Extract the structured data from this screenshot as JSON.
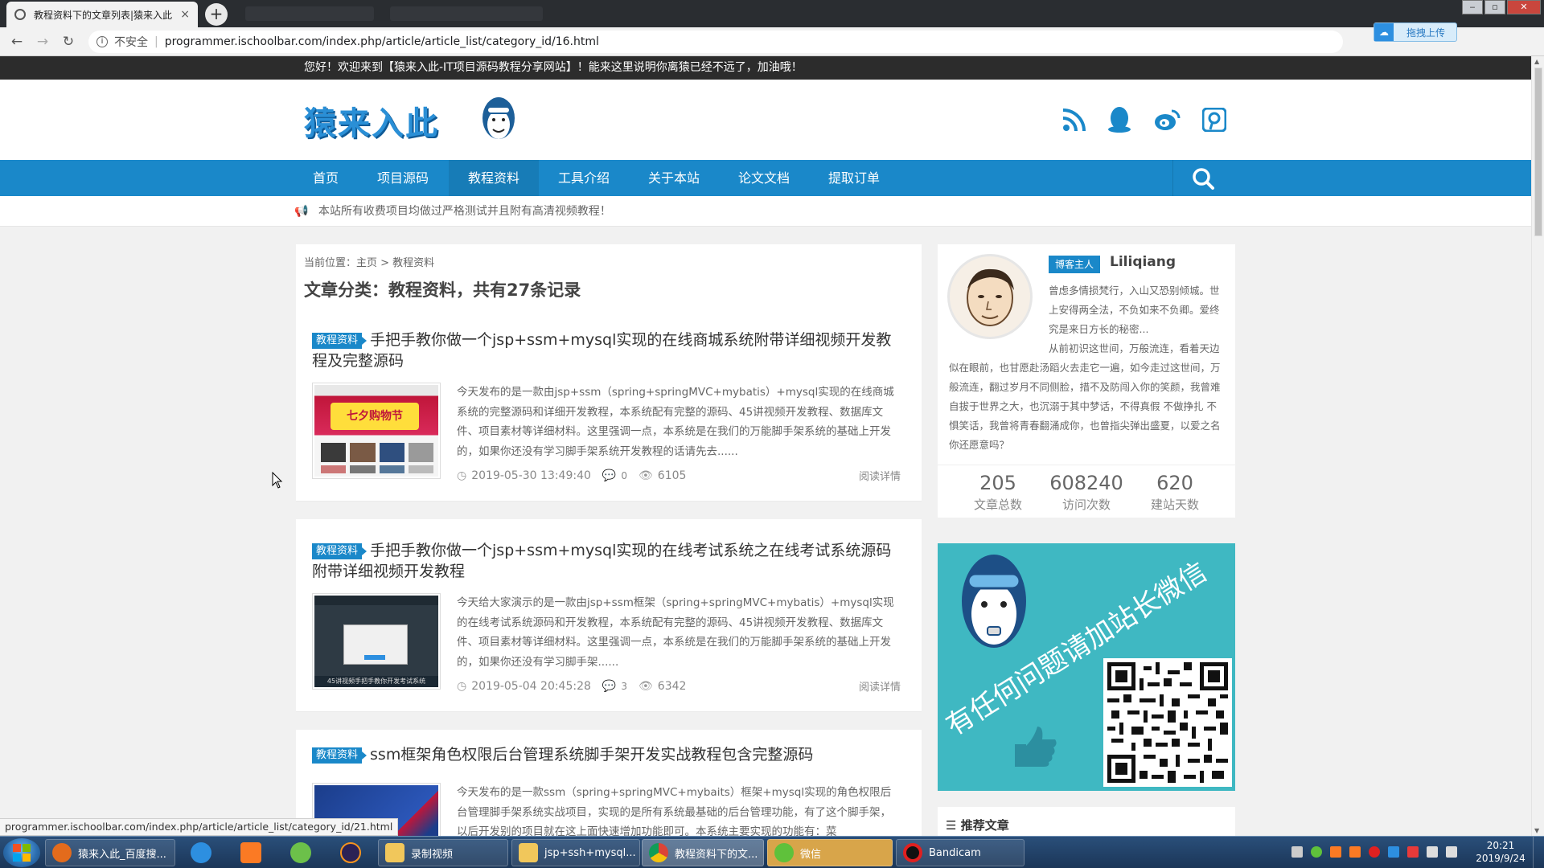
{
  "browser": {
    "tab_title": "教程资料下的文章列表|猿来入此",
    "tab_close": "×",
    "new_tab": "+",
    "insecure_label": "不安全",
    "url": "programmer.ischoolbar.com/index.php/article/article_list/category_id/16.html",
    "upload_label": "拖拽上传",
    "status_url": "programmer.ischoolbar.com/index.php/article/article_list/category_id/21.html"
  },
  "site": {
    "welcome": "您好！欢迎来到【猿来入此-IT项目源码教程分享网站】！能来这里说明你离猿已经不远了，加油哦！",
    "logo_text": "猿来入此",
    "notice": "本站所有收费项目均做过严格测试并且附有高清视频教程！"
  },
  "nav": [
    {
      "label": "首页"
    },
    {
      "label": "项目源码"
    },
    {
      "label": "教程资料"
    },
    {
      "label": "工具介绍"
    },
    {
      "label": "关于本站"
    },
    {
      "label": "论文文档"
    },
    {
      "label": "提取订单"
    }
  ],
  "listing": {
    "breadcrumb": "当前位置：主页 > 教程资料",
    "category_title": "文章分类：教程资料，共有27条记录"
  },
  "articles": [
    {
      "badge": "教程资料",
      "title": "手把手教你做一个jsp+ssm+mysql实现的在线商城系统附带详细视频开发教程及完整源码",
      "desc": "今天发布的是一款由jsp+ssm（spring+springMVC+mybatis）+mysql实现的在线商城系统的完整源码和详细开发教程，本系统配有完整的源码、45讲视频开发教程、数据库文件、项目素材等详细材料。这里强调一点，本系统是在我们的万能脚手架系统的基础上开发的，如果你还没有学习脚手架系统开发教程的话请先去......",
      "date": "2019-05-30 13:49:40",
      "comments": "0",
      "views": "6105",
      "read_more": "阅读详情",
      "thumb_caption": "七夕购物节"
    },
    {
      "badge": "教程资料",
      "title": "手把手教你做一个jsp+ssm+mysql实现的在线考试系统之在线考试系统源码附带详细视频开发教程",
      "desc": "今天给大家演示的是一款由jsp+ssm框架（spring+springMVC+mybatis）+mysql实现的在线考试系统源码和开发教程，本系统配有完整的源码、45讲视频开发教程、数据库文件、项目素材等详细材料。这里强调一点，本系统是在我们的万能脚手架系统的基础上开发的，如果你还没有学习脚手架......",
      "date": "2019-05-04 20:45:28",
      "comments": "3",
      "views": "6342",
      "read_more": "阅读详情",
      "thumb_caption": "45讲视频手把手教你开发考试系统"
    },
    {
      "badge": "教程资料",
      "title": "ssm框架角色权限后台管理系统脚手架开发实战教程包含完整源码",
      "desc": "今天发布的是一款ssm（spring+springMVC+mybaits）框架+mysql实现的角色权限后台管理脚手架系统实战项目，实现的是所有系统最基础的后台管理功能，有了这个脚手架，以后开发别的项目就在这上面快速增加功能即可。本系统主要实现的功能有：菜"
    }
  ],
  "profile": {
    "badge": "博客主人",
    "name": "Liliqiang",
    "bio_1": "曾虑多情损梵行，入山又恐别倾城。世上安得两全法，不负如来不负卿。爱终究是来日方长的秘密...",
    "bio_2": "从前初识这世间，万般流连，看着天边似在眼前，也甘愿赴汤蹈火去走它一遍，如今走过这世间，万般流连，翻过岁月不同侧脸，措不及防闯入你的笑颜，我曾难自拔于世界之大，也沉溺于其中梦话，不得真假 不做挣扎 不惧笑话，我曾将青春翻涌成你，也曾指尖弹出盛夏，以爱之名 你还愿意吗？",
    "stats": [
      {
        "value": "205",
        "label": "文章总数"
      },
      {
        "value": "608240",
        "label": "访问次数"
      },
      {
        "value": "620",
        "label": "建站天数"
      }
    ]
  },
  "ad": {
    "text": "有任何问题请加站长微信"
  },
  "recommend": {
    "title": "推荐文章"
  },
  "taskbar": {
    "items": [
      {
        "label": "猿来入此_百度搜..."
      },
      {
        "label": "录制视频"
      },
      {
        "label": "jsp+ssh+mysql..."
      },
      {
        "label": "教程资料下的文..."
      },
      {
        "label": "微信"
      },
      {
        "label": "Bandicam"
      }
    ],
    "time": "20:21",
    "date": "2019/9/24"
  }
}
